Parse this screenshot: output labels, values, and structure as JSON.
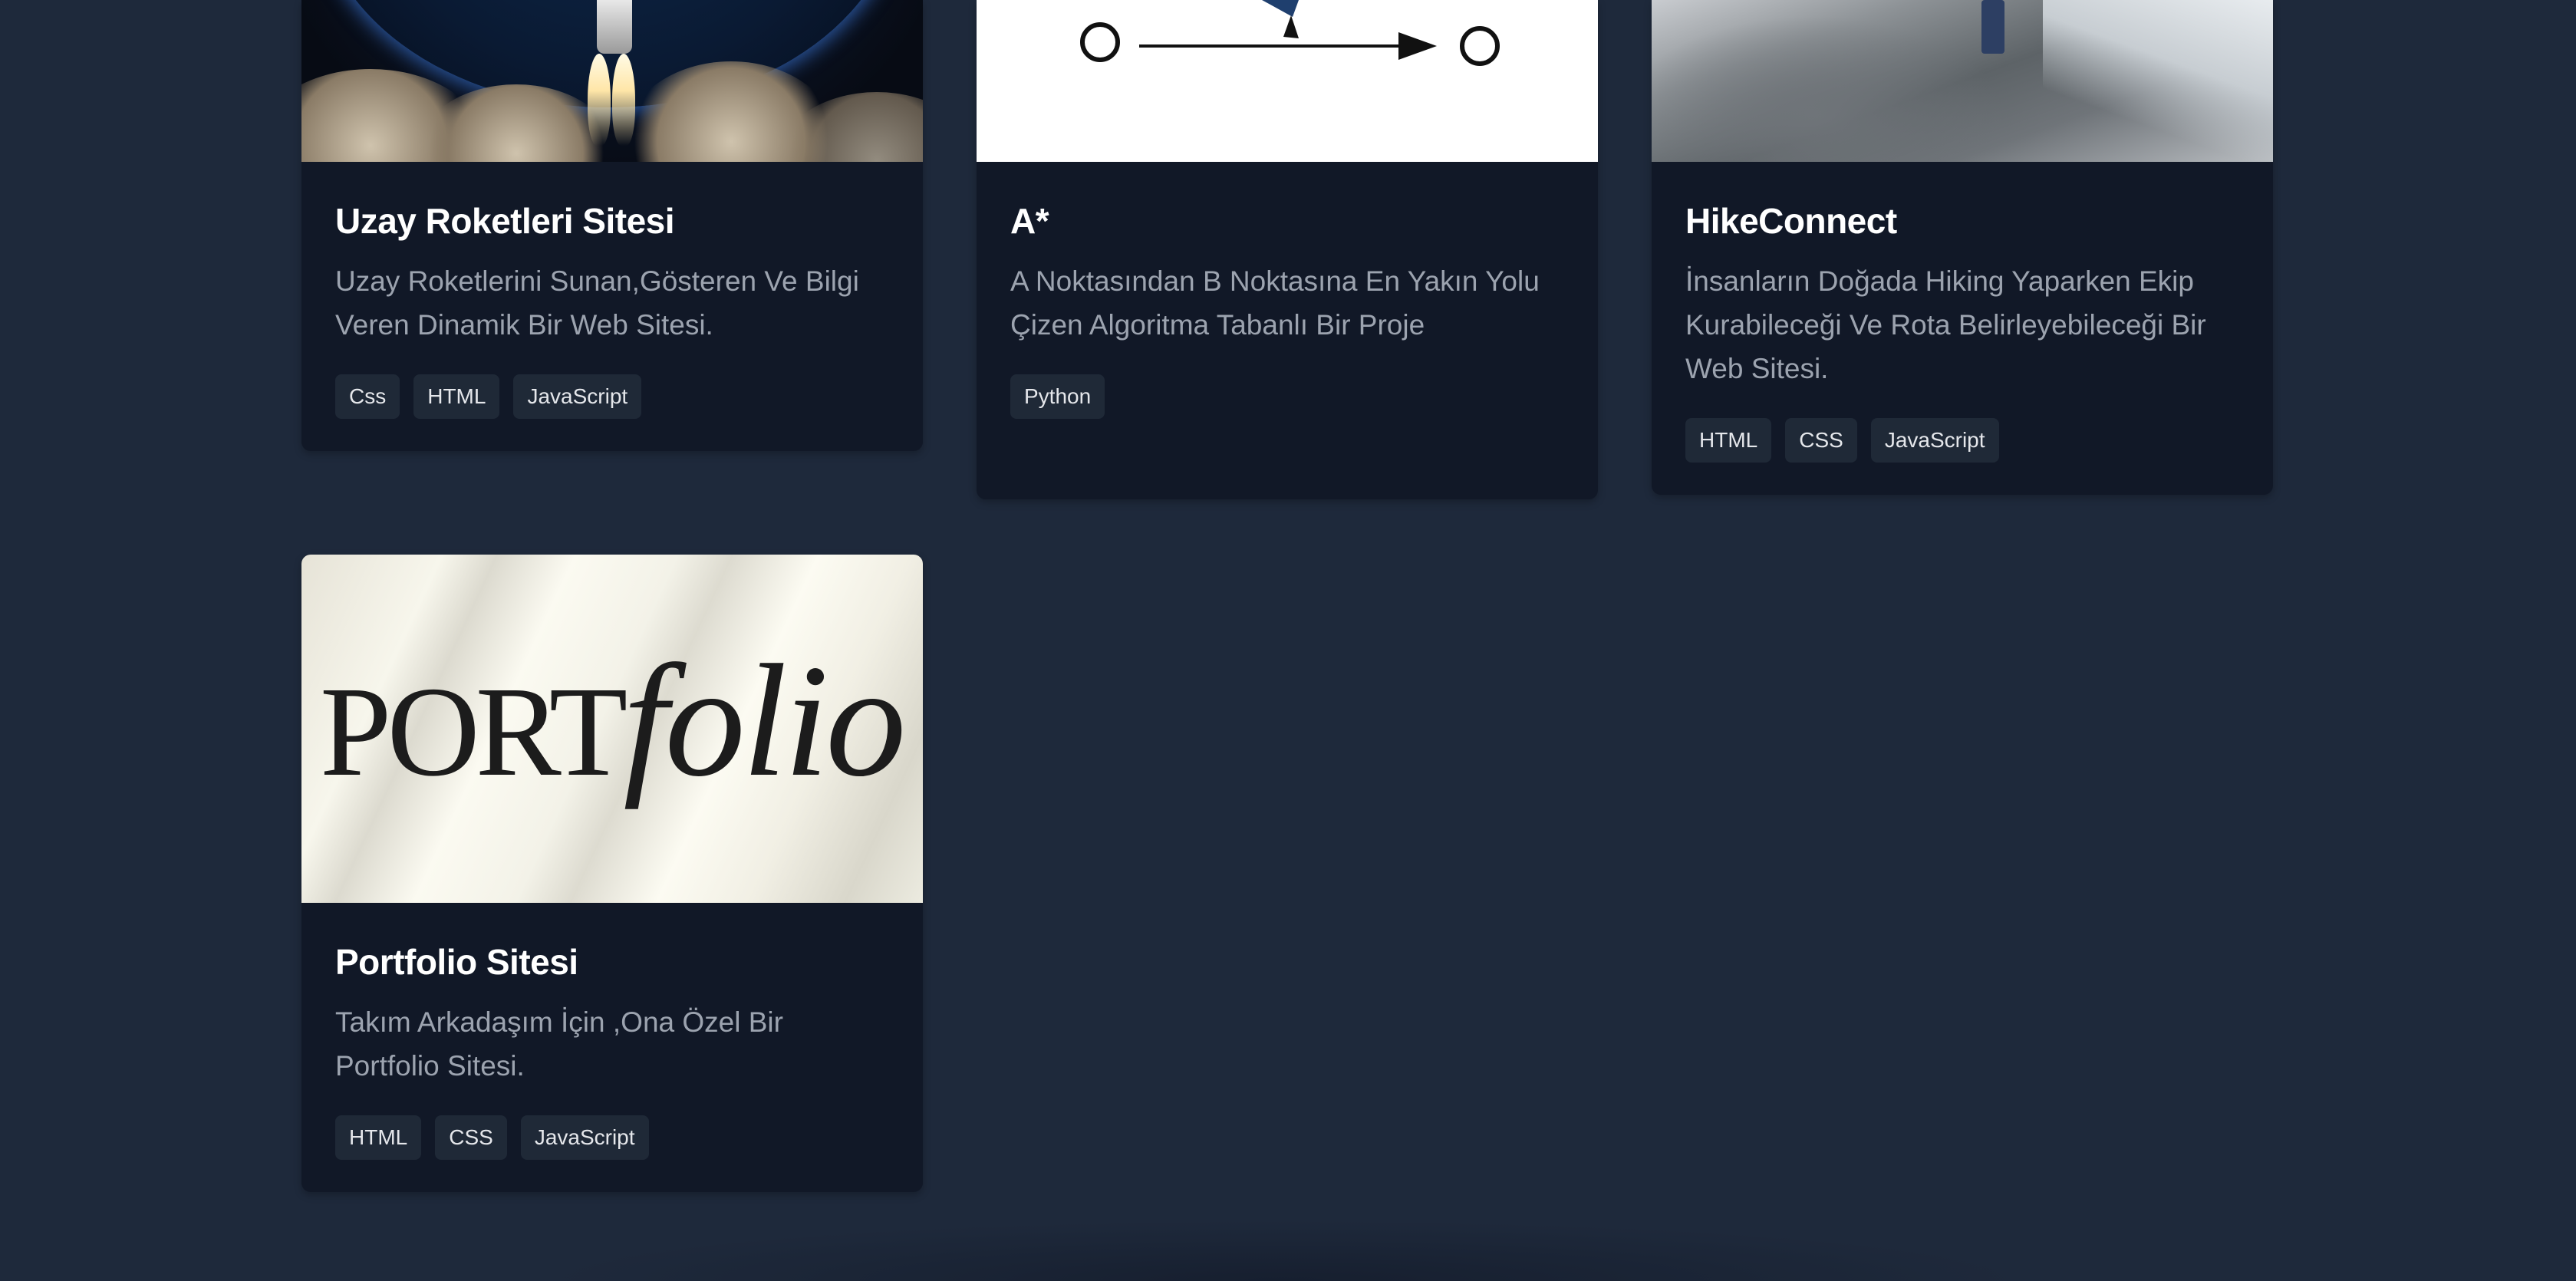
{
  "projects": [
    {
      "title": "Uzay Roketleri Sitesi",
      "description": "Uzay Roketlerini Sunan,Gösteren Ve Bilgi Veren Dinamik Bir Web Sitesi.",
      "tags": [
        "Css",
        "HTML",
        "JavaScript"
      ],
      "image": "rocket-launch-image"
    },
    {
      "title": "A*",
      "description": "A Noktasından B Noktasına En Yakın Yolu Çizen Algoritma Tabanlı Bir Proje",
      "tags": [
        "Python"
      ],
      "image": "pathfinding-diagram-image"
    },
    {
      "title": "HikeConnect",
      "description": "İnsanların Doğada Hiking Yaparken Ekip Kurabileceği Ve Rota Belirleyebileceği Bir Web Sitesi.",
      "tags": [
        "HTML",
        "CSS",
        "JavaScript"
      ],
      "image": "mountain-hiker-image"
    },
    {
      "title": "Portfolio Sitesi",
      "description": "Takım Arkadaşım İçin ,Ona Özel Bir Portfolio Sitesi.",
      "tags": [
        "HTML",
        "CSS",
        "JavaScript"
      ],
      "image": "portfolio-logo-image",
      "image_text_caps": "PORT",
      "image_text_italic": "folio"
    }
  ],
  "colors": {
    "page_background": "#1e293b",
    "card_background": "#111827",
    "tag_background": "#1f2937",
    "title_text": "#ffffff",
    "description_text": "#9ca3af"
  }
}
